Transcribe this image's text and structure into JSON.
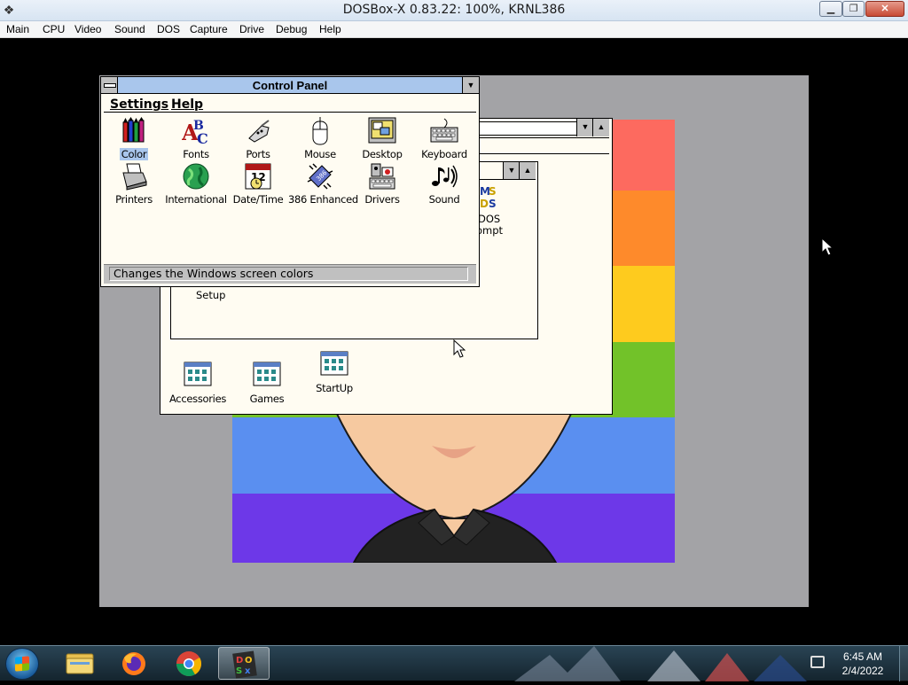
{
  "host": {
    "title": "DOSBox-X 0.83.22: 100%, KRNL386",
    "menu": [
      "Main",
      "CPU",
      "Video",
      "Sound",
      "DOS",
      "Capture",
      "Drive",
      "Debug",
      "Help"
    ]
  },
  "control_panel": {
    "title": "Control Panel",
    "menu": [
      "Settings",
      "Help"
    ],
    "icons_row1": [
      "Color",
      "Fonts",
      "Ports",
      "Mouse",
      "Desktop",
      "Keyboard"
    ],
    "icons_row2": [
      "Printers",
      "International",
      "Date/Time",
      "386 Enhanced",
      "Drivers",
      "Sound"
    ],
    "selected": "Color",
    "status": "Changes the Windows screen colors"
  },
  "program_manager": {
    "inner_partial_labels": [
      "Setup",
      "DOS",
      "ompt"
    ],
    "group_icons": [
      "Accessories",
      "Games",
      "StartUp"
    ]
  },
  "taskbar": {
    "time": "6:45 AM",
    "date": "2/4/2022"
  },
  "colors": {
    "stripes": [
      "#fd6a5f",
      "#fe8a2b",
      "#fecb1e",
      "#72c229",
      "#5a8ff0",
      "#6d38e8"
    ],
    "caption_active": "#a9c6ec",
    "desktop": "#a3a3a6"
  }
}
